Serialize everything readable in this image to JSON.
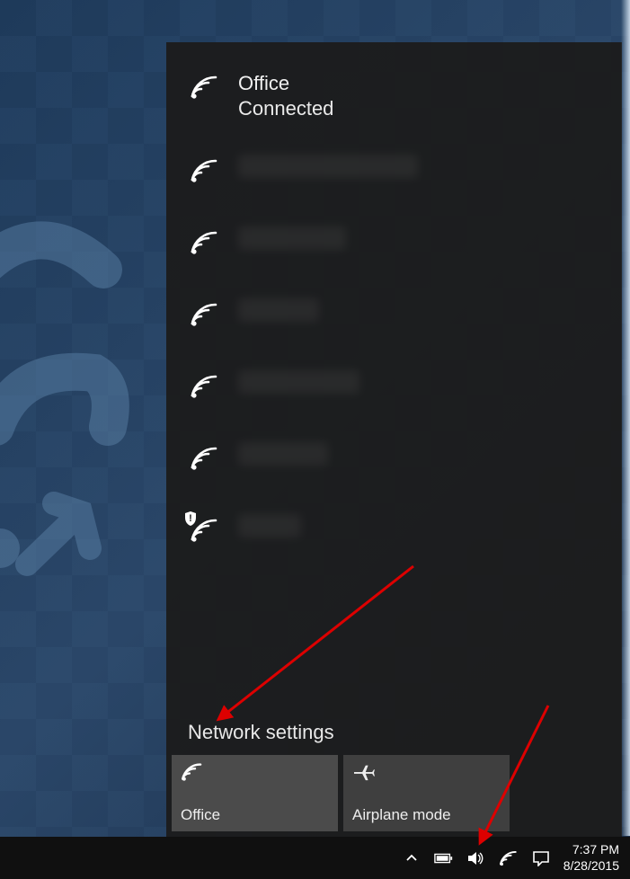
{
  "flyout": {
    "connected": {
      "name": "Office",
      "status": "Connected"
    },
    "settings_label": "Network settings",
    "tiles": {
      "wifi_label": "Office",
      "airplane_label": "Airplane mode"
    }
  },
  "taskbar": {
    "time": "7:37 PM",
    "date": "8/28/2015"
  }
}
